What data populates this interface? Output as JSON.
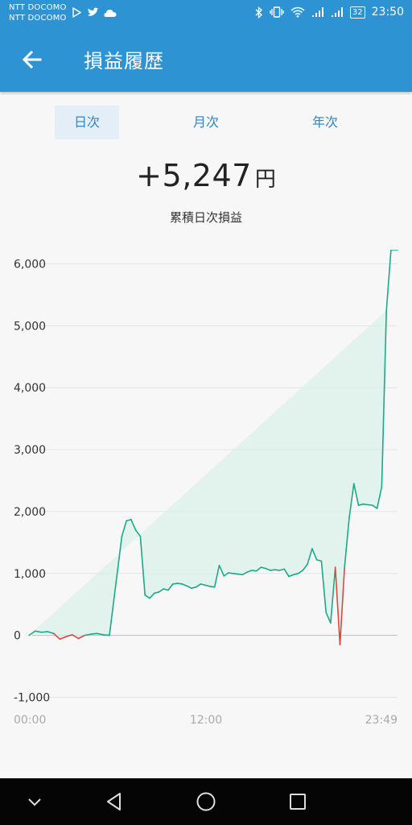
{
  "status_bar": {
    "carrier_1": "NTT DOCOMO",
    "carrier_2": "NTT DOCOMO",
    "battery": "32",
    "time": "23:50"
  },
  "app_bar": {
    "title": "損益履歴",
    "back_icon": "arrow-left-icon"
  },
  "tabs": [
    {
      "label": "日次",
      "active": true
    },
    {
      "label": "月次",
      "active": false
    },
    {
      "label": "年次",
      "active": false
    }
  ],
  "summary": {
    "amount": "+5,247",
    "unit": "円",
    "label": "累積日次損益"
  },
  "colors": {
    "accent": "#2d93d3",
    "line": "#1aaa86",
    "negative": "#e0473b",
    "fill": "#d8efe8"
  },
  "chart_data": {
    "type": "area",
    "title": "",
    "xlabel": "",
    "ylabel": "",
    "ylim": [
      -1000,
      6000
    ],
    "yticks": [
      "6,000",
      "5,000",
      "4,000",
      "3,000",
      "2,000",
      "1,000",
      "0",
      "-1,000"
    ],
    "xticks": [
      "00:00",
      "12:00",
      "23:49"
    ],
    "grid": true,
    "x_hours": [
      0,
      0.4,
      0.8,
      1.2,
      1.6,
      2.0,
      2.4,
      2.8,
      3.2,
      3.6,
      4.0,
      4.4,
      4.8,
      5.2,
      5.6,
      6.0,
      6.3,
      6.6,
      6.9,
      7.2,
      7.5,
      7.8,
      8.1,
      8.4,
      8.7,
      9.0,
      9.3,
      9.6,
      9.9,
      10.2,
      10.5,
      10.8,
      11.1,
      11.4,
      11.7,
      12.0,
      12.3,
      12.6,
      12.9,
      13.2,
      13.5,
      13.8,
      14.1,
      14.4,
      14.7,
      15.0,
      15.3,
      15.6,
      15.9,
      16.2,
      16.5,
      16.8,
      17.1,
      17.4,
      17.7,
      18.0,
      18.3,
      18.6,
      18.9,
      19.2,
      19.5,
      19.8,
      20.1,
      20.4,
      20.7,
      21.0,
      21.3,
      21.6,
      21.9,
      22.2,
      22.5,
      22.8,
      23.1,
      23.4,
      23.6,
      23.8,
      23.82
    ],
    "values": [
      0,
      70,
      50,
      60,
      30,
      -60,
      -20,
      10,
      -50,
      0,
      20,
      30,
      10,
      0,
      800,
      1600,
      1850,
      1870,
      1700,
      1600,
      650,
      600,
      680,
      700,
      750,
      730,
      830,
      840,
      830,
      800,
      760,
      780,
      830,
      810,
      790,
      780,
      1130,
      960,
      1010,
      1000,
      990,
      980,
      1020,
      1050,
      1040,
      1100,
      1080,
      1050,
      1060,
      1050,
      1070,
      950,
      980,
      1000,
      1050,
      1150,
      1400,
      1220,
      1200,
      370,
      200,
      1100,
      -150,
      1100,
      1900,
      2450,
      2100,
      2120,
      2110,
      2100,
      2050,
      2400,
      5247
    ]
  }
}
